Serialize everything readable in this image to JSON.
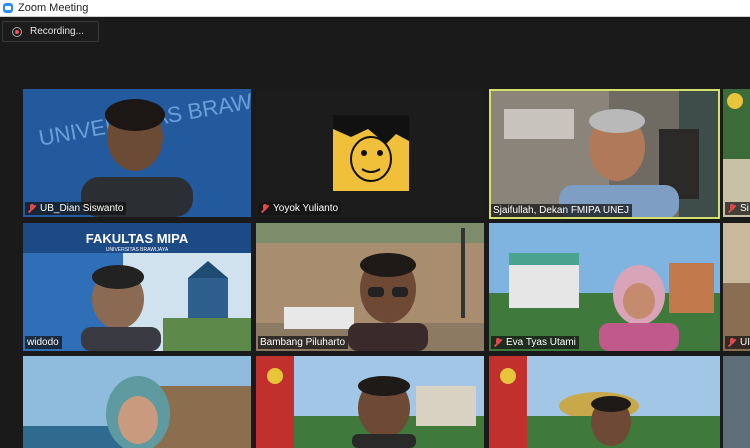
{
  "window": {
    "title": "Zoom Meeting"
  },
  "recording": {
    "label": "Recording..."
  },
  "tiles": [
    {
      "name": "UB_Dian Siswanto",
      "muted": true
    },
    {
      "name": "Yoyok Yulianto",
      "muted": true
    },
    {
      "name": "Sjaifullah, Dekan FMIPA UNEJ",
      "muted": false,
      "active": true
    },
    {
      "name": "Si",
      "muted": true
    },
    {
      "name": "widodo",
      "muted": false
    },
    {
      "name": "Bambang Piluharto",
      "muted": false
    },
    {
      "name": "Eva Tyas Utami",
      "muted": true
    },
    {
      "name": "UI",
      "muted": true
    },
    {
      "name": "",
      "muted": false
    },
    {
      "name": "",
      "muted": false
    },
    {
      "name": "",
      "muted": false
    },
    {
      "name": "",
      "muted": false
    }
  ],
  "backgrounds": {
    "fmipa": {
      "title": "FAKULTAS MIPA",
      "subtitle": "UNIVERSITAS BRAWIJAYA"
    },
    "ub_watermark": "UNIVERSITAS BRAWIJAYA"
  },
  "colors": {
    "active_speaker": "#d4e06a",
    "muted_icon": "#e04a4a",
    "accent": "#2d8cff"
  }
}
